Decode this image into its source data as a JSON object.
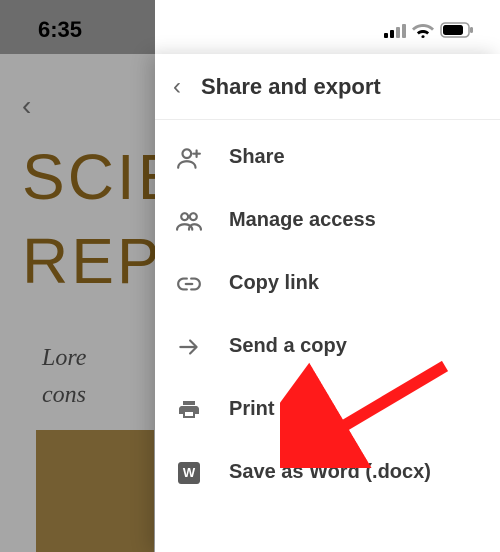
{
  "status": {
    "time": "6:35"
  },
  "doc": {
    "back_glyph": "‹",
    "title_line1": "SCIE",
    "title_line2": "REPO",
    "body_line1": "Lore",
    "body_line2": "cons"
  },
  "panel": {
    "back_glyph": "‹",
    "title": "Share and export"
  },
  "menu": {
    "items": [
      {
        "id": "share",
        "icon": "person-add-icon",
        "label": "Share"
      },
      {
        "id": "manage-access",
        "icon": "people-icon",
        "label": "Manage access"
      },
      {
        "id": "copy-link",
        "icon": "link-icon",
        "label": "Copy link"
      },
      {
        "id": "send-copy",
        "icon": "send-icon",
        "label": "Send a copy"
      },
      {
        "id": "print",
        "icon": "print-icon",
        "label": "Print"
      },
      {
        "id": "save-word",
        "icon": "word-icon",
        "label": "Save as Word (.docx)"
      }
    ]
  },
  "annotation": {
    "arrow_target": "print"
  }
}
